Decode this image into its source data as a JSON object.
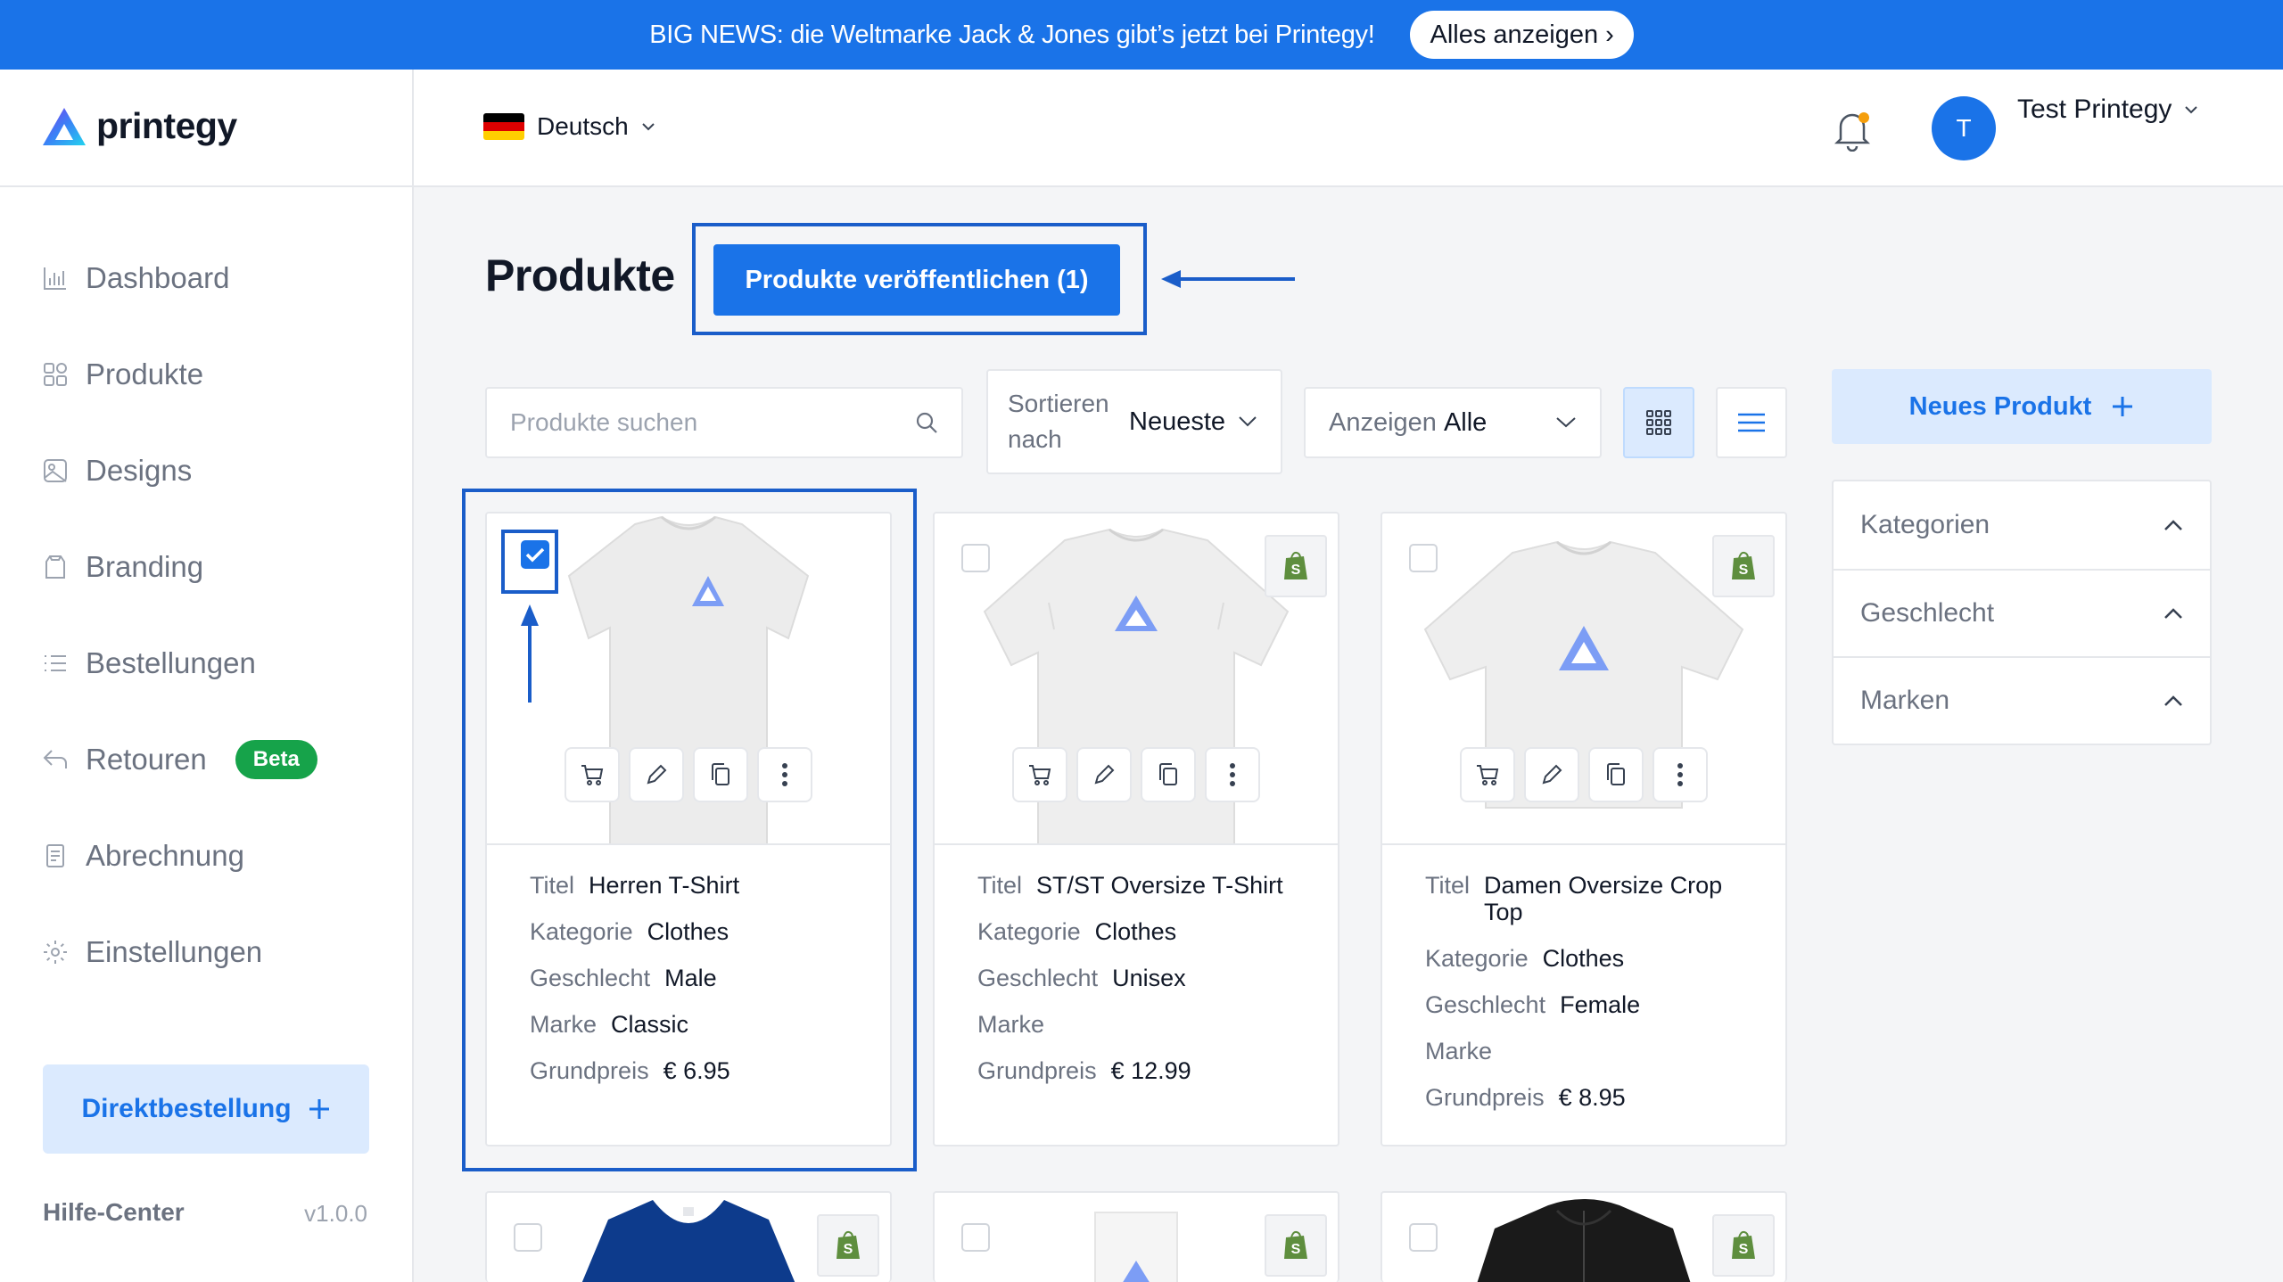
{
  "banner": {
    "text": "BIG NEWS: die Weltmarke Jack & Jones gibt’s jetzt bei Printegy!",
    "button_label": "Alles anzeigen",
    "button_arrow": "›"
  },
  "brand": {
    "name": "printegy"
  },
  "sidebar": {
    "items": [
      {
        "label": "Dashboard",
        "icon": "bar-chart-icon"
      },
      {
        "label": "Produkte",
        "icon": "grid-icon"
      },
      {
        "label": "Designs",
        "icon": "image-icon"
      },
      {
        "label": "Branding",
        "icon": "tag-icon"
      },
      {
        "label": "Bestellungen",
        "icon": "list-icon"
      },
      {
        "label": "Retouren",
        "icon": "return-icon",
        "badge": "Beta"
      },
      {
        "label": "Abrechnung",
        "icon": "invoice-icon"
      },
      {
        "label": "Einstellungen",
        "icon": "gear-icon"
      }
    ],
    "direct_order_label": "Direktbestellung",
    "help_label": "Hilfe-Center",
    "version": "v1.0.0"
  },
  "header": {
    "language": "Deutsch",
    "user": {
      "initial": "T",
      "name": "Test Printegy"
    }
  },
  "main": {
    "title": "Produkte",
    "publish_label": "Produkte veröffentlichen (1)",
    "search_placeholder": "Produkte suchen",
    "sort": {
      "label": "Sortieren nach",
      "value": "Neueste"
    },
    "show": {
      "label": "Anzeigen",
      "value": "Alle"
    },
    "new_product_label": "Neues Produkt",
    "filters": [
      "Kategorien",
      "Geschlecht",
      "Marken"
    ],
    "field_labels": {
      "title": "Titel",
      "category": "Kategorie",
      "gender": "Geschlecht",
      "brand": "Marke",
      "base_price": "Grundpreis"
    },
    "products": [
      {
        "title": "Herren T-Shirt",
        "category": "Clothes",
        "gender": "Male",
        "brand": "Classic",
        "price": "€ 6.95",
        "selected": true,
        "shopify": false
      },
      {
        "title": "ST/ST Oversize T-Shirt",
        "category": "Clothes",
        "gender": "Unisex",
        "brand": "",
        "price": "€ 12.99",
        "selected": false,
        "shopify": true
      },
      {
        "title": "Damen Oversize Crop Top",
        "category": "Clothes",
        "gender": "Female",
        "brand": "",
        "price": "€ 8.95",
        "selected": false,
        "shopify": true
      }
    ]
  },
  "colors": {
    "accent": "#1a73e8",
    "highlight": "#1a5dc9",
    "beta": "#16a34a",
    "shopify": "#5e8e3e"
  }
}
